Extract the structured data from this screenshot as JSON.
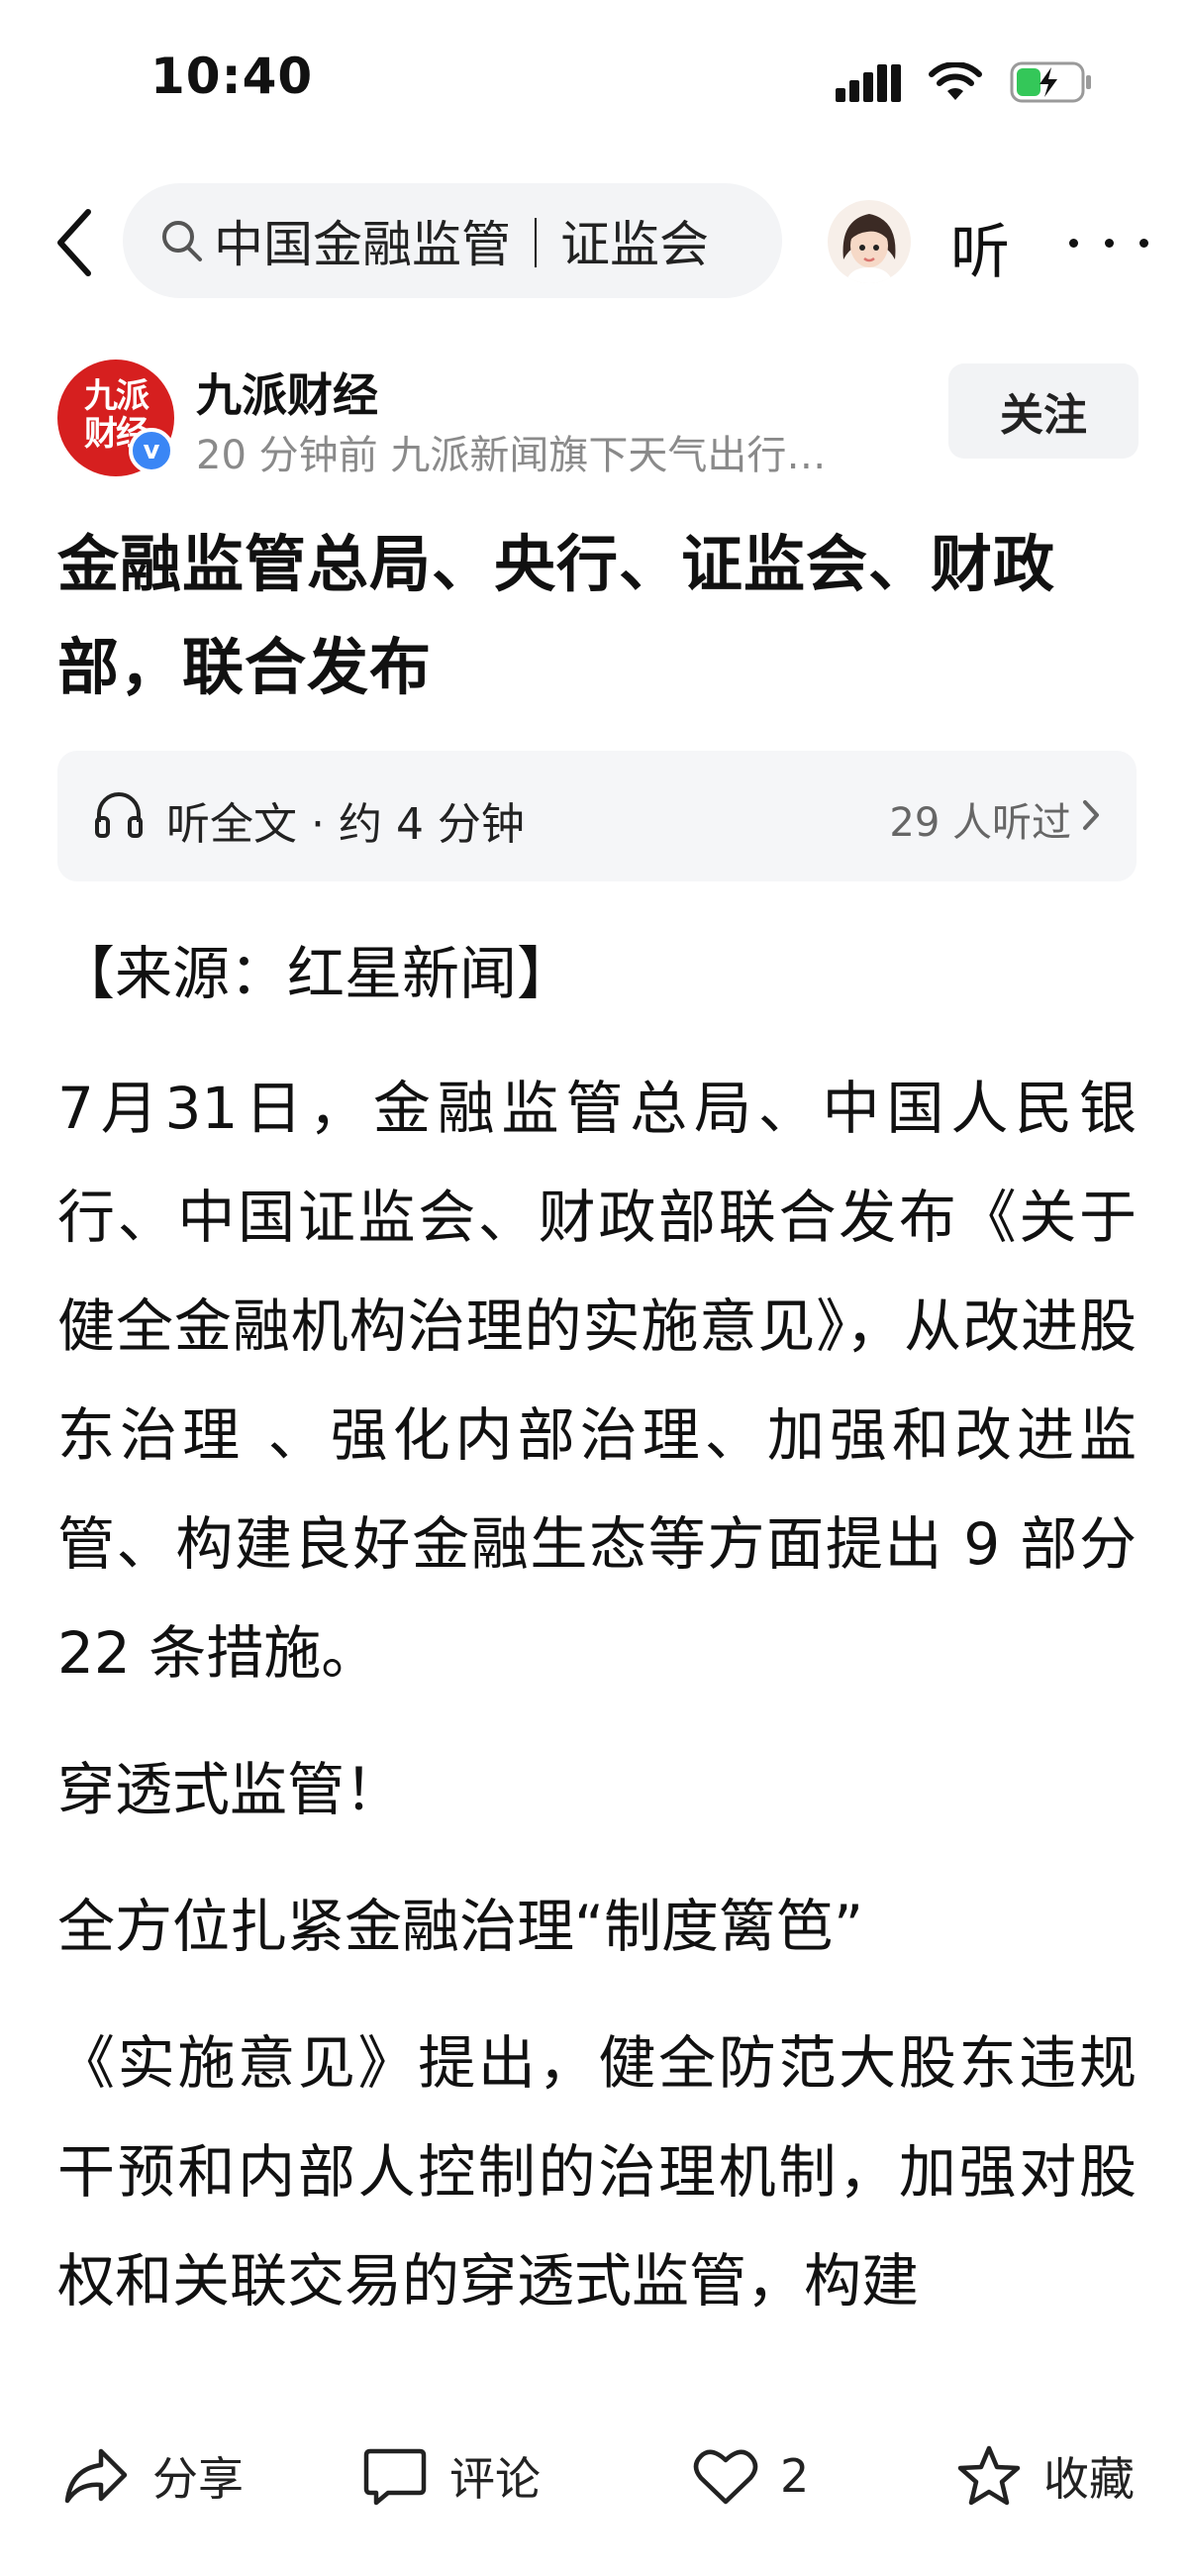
{
  "status_bar": {
    "time": "10:40"
  },
  "nav": {
    "search_text": "中国金融监管｜证监会",
    "listen_label": "听"
  },
  "author": {
    "logo_text_line1": "九派",
    "logo_text_line2": "财经",
    "verified_mark": "v",
    "name": "九派财经",
    "meta": "20 分钟前  九派新闻旗下天气出行…",
    "follow_label": "关注"
  },
  "article": {
    "title": "金融监管总局、央行、证监会、财政部，联合发布",
    "listen_label": "听全文 · 约 4 分钟",
    "listen_count": "29 人听过",
    "paragraphs": [
      "【来源：红星新闻】",
      "7月31日，金融监管总局、中国人民银行、中国证监会、财政部联合发布《关于健全金融机构治理的实施意见》，从改进股东治理  、强化内部治理、加强和改进监管、构建良好金融生态等方面提出 9 部分 22 条措施。",
      "穿透式监管！",
      "全方位扎紧金融治理“制度篱笆”",
      "《实施意见》提出，健全防范大股东违规干预和内部人控制的治理机制，加强对股权和关联交易的穿透式监管，构建"
    ]
  },
  "bottom_bar": {
    "share_label": "分享",
    "comment_label": "评论",
    "like_count": "2",
    "collect_label": "收藏"
  },
  "colors": {
    "brand_red": "#d61f1f",
    "verified_blue": "#3a86f5",
    "battery_green": "#34c759"
  }
}
